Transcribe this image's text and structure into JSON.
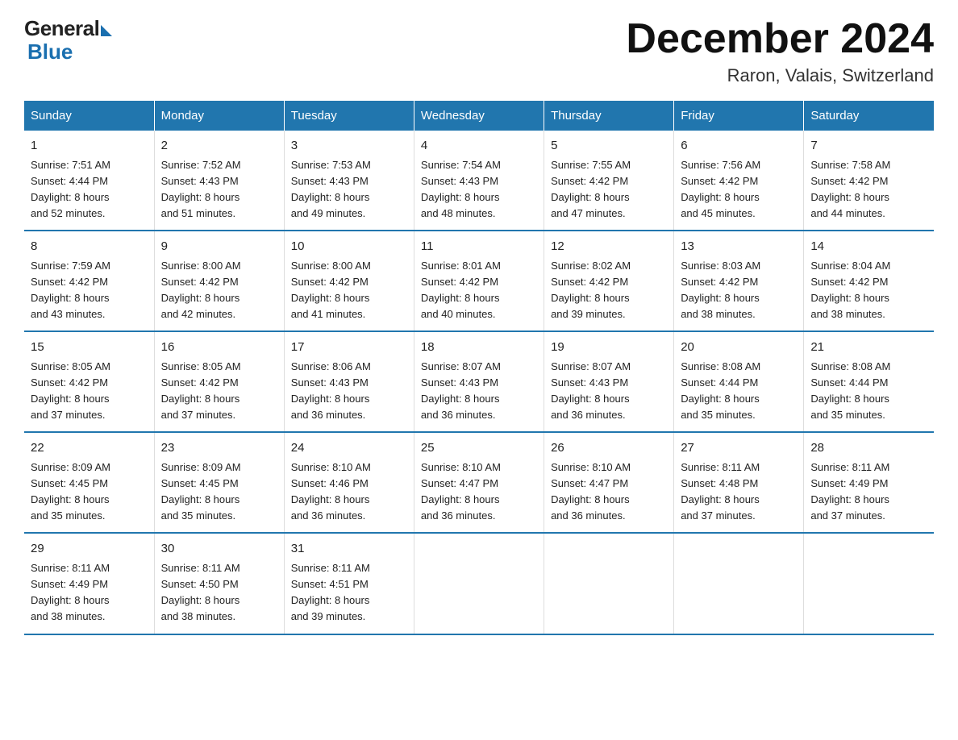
{
  "header": {
    "logo_general": "General",
    "logo_blue": "Blue",
    "month_title": "December 2024",
    "location": "Raron, Valais, Switzerland"
  },
  "days_of_week": [
    "Sunday",
    "Monday",
    "Tuesday",
    "Wednesday",
    "Thursday",
    "Friday",
    "Saturday"
  ],
  "weeks": [
    [
      {
        "day": "1",
        "sunrise": "7:51 AM",
        "sunset": "4:44 PM",
        "daylight": "8 hours and 52 minutes."
      },
      {
        "day": "2",
        "sunrise": "7:52 AM",
        "sunset": "4:43 PM",
        "daylight": "8 hours and 51 minutes."
      },
      {
        "day": "3",
        "sunrise": "7:53 AM",
        "sunset": "4:43 PM",
        "daylight": "8 hours and 49 minutes."
      },
      {
        "day": "4",
        "sunrise": "7:54 AM",
        "sunset": "4:43 PM",
        "daylight": "8 hours and 48 minutes."
      },
      {
        "day": "5",
        "sunrise": "7:55 AM",
        "sunset": "4:42 PM",
        "daylight": "8 hours and 47 minutes."
      },
      {
        "day": "6",
        "sunrise": "7:56 AM",
        "sunset": "4:42 PM",
        "daylight": "8 hours and 45 minutes."
      },
      {
        "day": "7",
        "sunrise": "7:58 AM",
        "sunset": "4:42 PM",
        "daylight": "8 hours and 44 minutes."
      }
    ],
    [
      {
        "day": "8",
        "sunrise": "7:59 AM",
        "sunset": "4:42 PM",
        "daylight": "8 hours and 43 minutes."
      },
      {
        "day": "9",
        "sunrise": "8:00 AM",
        "sunset": "4:42 PM",
        "daylight": "8 hours and 42 minutes."
      },
      {
        "day": "10",
        "sunrise": "8:00 AM",
        "sunset": "4:42 PM",
        "daylight": "8 hours and 41 minutes."
      },
      {
        "day": "11",
        "sunrise": "8:01 AM",
        "sunset": "4:42 PM",
        "daylight": "8 hours and 40 minutes."
      },
      {
        "day": "12",
        "sunrise": "8:02 AM",
        "sunset": "4:42 PM",
        "daylight": "8 hours and 39 minutes."
      },
      {
        "day": "13",
        "sunrise": "8:03 AM",
        "sunset": "4:42 PM",
        "daylight": "8 hours and 38 minutes."
      },
      {
        "day": "14",
        "sunrise": "8:04 AM",
        "sunset": "4:42 PM",
        "daylight": "8 hours and 38 minutes."
      }
    ],
    [
      {
        "day": "15",
        "sunrise": "8:05 AM",
        "sunset": "4:42 PM",
        "daylight": "8 hours and 37 minutes."
      },
      {
        "day": "16",
        "sunrise": "8:05 AM",
        "sunset": "4:42 PM",
        "daylight": "8 hours and 37 minutes."
      },
      {
        "day": "17",
        "sunrise": "8:06 AM",
        "sunset": "4:43 PM",
        "daylight": "8 hours and 36 minutes."
      },
      {
        "day": "18",
        "sunrise": "8:07 AM",
        "sunset": "4:43 PM",
        "daylight": "8 hours and 36 minutes."
      },
      {
        "day": "19",
        "sunrise": "8:07 AM",
        "sunset": "4:43 PM",
        "daylight": "8 hours and 36 minutes."
      },
      {
        "day": "20",
        "sunrise": "8:08 AM",
        "sunset": "4:44 PM",
        "daylight": "8 hours and 35 minutes."
      },
      {
        "day": "21",
        "sunrise": "8:08 AM",
        "sunset": "4:44 PM",
        "daylight": "8 hours and 35 minutes."
      }
    ],
    [
      {
        "day": "22",
        "sunrise": "8:09 AM",
        "sunset": "4:45 PM",
        "daylight": "8 hours and 35 minutes."
      },
      {
        "day": "23",
        "sunrise": "8:09 AM",
        "sunset": "4:45 PM",
        "daylight": "8 hours and 35 minutes."
      },
      {
        "day": "24",
        "sunrise": "8:10 AM",
        "sunset": "4:46 PM",
        "daylight": "8 hours and 36 minutes."
      },
      {
        "day": "25",
        "sunrise": "8:10 AM",
        "sunset": "4:47 PM",
        "daylight": "8 hours and 36 minutes."
      },
      {
        "day": "26",
        "sunrise": "8:10 AM",
        "sunset": "4:47 PM",
        "daylight": "8 hours and 36 minutes."
      },
      {
        "day": "27",
        "sunrise": "8:11 AM",
        "sunset": "4:48 PM",
        "daylight": "8 hours and 37 minutes."
      },
      {
        "day": "28",
        "sunrise": "8:11 AM",
        "sunset": "4:49 PM",
        "daylight": "8 hours and 37 minutes."
      }
    ],
    [
      {
        "day": "29",
        "sunrise": "8:11 AM",
        "sunset": "4:49 PM",
        "daylight": "8 hours and 38 minutes."
      },
      {
        "day": "30",
        "sunrise": "8:11 AM",
        "sunset": "4:50 PM",
        "daylight": "8 hours and 38 minutes."
      },
      {
        "day": "31",
        "sunrise": "8:11 AM",
        "sunset": "4:51 PM",
        "daylight": "8 hours and 39 minutes."
      },
      null,
      null,
      null,
      null
    ]
  ],
  "label_sunrise": "Sunrise:",
  "label_sunset": "Sunset:",
  "label_daylight": "Daylight:"
}
